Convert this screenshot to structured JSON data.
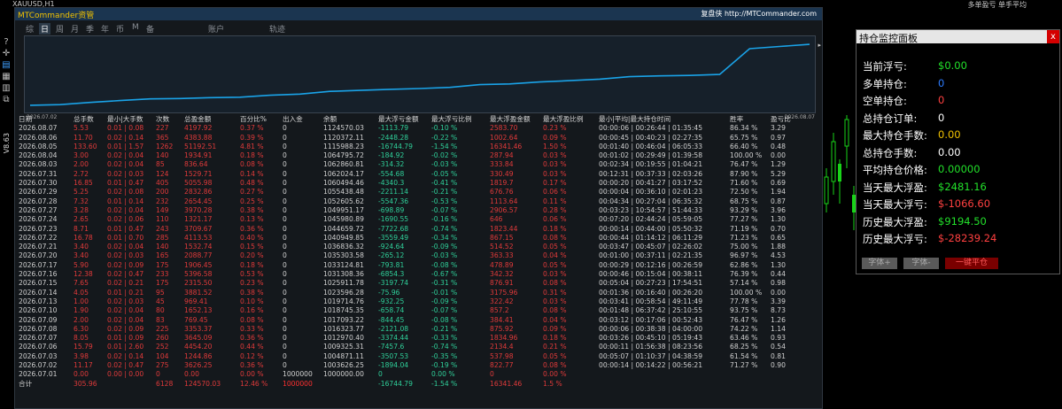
{
  "chart": {
    "symbol_title": "XAUUSD,H1",
    "top_right_text": "多单盈亏 单手平均",
    "version_label": "V8.63"
  },
  "toolbar": {
    "icons": [
      "question-icon",
      "crosshair-icon",
      "chart-icon",
      "grid-icon",
      "table-icon",
      "window-icon"
    ]
  },
  "panel": {
    "title": "MTCommander资管",
    "link": "复盘侠 http://MTCommander.com",
    "tabs": [
      "综",
      "日",
      "周",
      "月",
      "季",
      "年",
      "币",
      "M",
      "备",
      "账户",
      "轨迹"
    ],
    "active_tab": "日",
    "chart_start_date": "2026.07.02",
    "chart_end_date": "2026.08.07"
  },
  "chart_data": {
    "type": "line",
    "x": [
      "2026.07.02",
      "2026.07.03",
      "2026.07.06",
      "2026.07.07",
      "2026.07.08",
      "2026.07.09",
      "2026.07.10",
      "2026.07.13",
      "2026.07.14",
      "2026.07.15",
      "2026.07.16",
      "2026.07.17",
      "2026.07.20",
      "2026.07.21",
      "2026.07.22",
      "2026.07.23",
      "2026.07.24",
      "2026.07.27",
      "2026.07.28",
      "2026.07.29",
      "2026.07.30",
      "2026.07.31",
      "2026.08.03",
      "2026.08.04",
      "2026.08.05",
      "2026.08.06",
      "2026.08.07"
    ],
    "y": [
      1003626.25,
      1004871.11,
      1009325.31,
      1012970.4,
      1016323.77,
      1017093.22,
      1018745.35,
      1019714.76,
      1023596.28,
      1025911.78,
      1031308.36,
      1033124.81,
      1035303.58,
      1036836.32,
      1039187.64,
      1044659.72,
      1045980.89,
      1049951.17,
      1052605.62,
      1055438.48,
      1060494.46,
      1062024.17,
      1062860.81,
      1064795.72,
      1115988.23,
      1120372.11,
      1124570.03
    ],
    "ylim": [
      1000000,
      1130000
    ]
  },
  "table": {
    "headers": [
      "日期",
      "总手数",
      "最小|大手数",
      "次数",
      "总盈金额",
      "百分比%",
      "出入金",
      "余额",
      "最大浮亏金额",
      "最大浮亏比例",
      "最大浮盈金额",
      "最大浮盈比例",
      "最小|平均|最大持仓时间",
      "胜率",
      "盈亏比"
    ],
    "rows": [
      [
        "2026.08.07",
        "5.53",
        "0.01 | 0.08",
        "227",
        "4197.92",
        "0.37 %",
        "0",
        "1124570.03",
        "-1113.79",
        "-0.10 %",
        "2583.70",
        "0.23 %",
        "00:00:06 | 00:26:44 | 01:35:45",
        "86.34 %",
        "3.29"
      ],
      [
        "2026.08.06",
        "11.70",
        "0.02 | 0.14",
        "365",
        "4383.88",
        "0.39 %",
        "0",
        "1120372.11",
        "-2448.28",
        "-0.22 %",
        "1002.64",
        "0.09 %",
        "00:00:45 | 00:40:23 | 02:27:35",
        "65.75 %",
        "0.97"
      ],
      [
        "2026.08.05",
        "133.60",
        "0.01 | 1.57",
        "1262",
        "51192.51",
        "4.81 %",
        "0",
        "1115988.23",
        "-16744.79",
        "-1.54 %",
        "16341.46",
        "1.50 %",
        "00:01:40 | 00:46:04 | 06:05:33",
        "66.40 %",
        "0.48"
      ],
      [
        "2026.08.04",
        "3.00",
        "0.02 | 0.04",
        "140",
        "1934.91",
        "0.18 %",
        "0",
        "1064795.72",
        "-184.92",
        "-0.02 %",
        "287.94",
        "0.03 %",
        "00:01:02 | 00:29:49 | 01:39:58",
        "100.00 %",
        "0.00"
      ],
      [
        "2026.08.03",
        "2.00",
        "0.02 | 0.04",
        "85",
        "836.64",
        "0.08 %",
        "0",
        "1062860.81",
        "-314.32",
        "-0.03 %",
        "333.84",
        "0.03 %",
        "00:02:34 | 00:19:55 | 01:04:21",
        "76.47 %",
        "1.29"
      ],
      [
        "2026.07.31",
        "2.72",
        "0.02 | 0.03",
        "124",
        "1529.71",
        "0.14 %",
        "0",
        "1062024.17",
        "-554.68",
        "-0.05 %",
        "330.49",
        "0.03 %",
        "00:12:31 | 00:37:33 | 02:03:26",
        "87.90 %",
        "5.29"
      ],
      [
        "2026.07.30",
        "16.85",
        "0.01 | 0.47",
        "405",
        "5055.98",
        "0.48 %",
        "0",
        "1060494.46",
        "-4340.3",
        "-0.41 %",
        "1819.7",
        "0.17 %",
        "00:00:20 | 00:41:27 | 03:17:52",
        "71.60 %",
        "0.69"
      ],
      [
        "2026.07.29",
        "5.25",
        "0.02 | 0.08",
        "200",
        "2832.86",
        "0.27 %",
        "0",
        "1055438.48",
        "-2211.14",
        "-0.21 %",
        "676.76",
        "0.06 %",
        "00:00:04 | 00:36:10 | 02:01:23",
        "72.50 %",
        "1.94"
      ],
      [
        "2026.07.28",
        "7.32",
        "0.01 | 0.14",
        "232",
        "2654.45",
        "0.25 %",
        "0",
        "1052605.62",
        "-5547.36",
        "-0.53 %",
        "1113.64",
        "0.11 %",
        "00:04:34 | 00:27:04 | 06:35:32",
        "68.75 %",
        "0.87"
      ],
      [
        "2026.07.27",
        "3.28",
        "0.02 | 0.04",
        "149",
        "3970.28",
        "0.38 %",
        "0",
        "1049951.17",
        "-698.89",
        "-0.07 %",
        "2906.57",
        "0.28 %",
        "00:03:23 | 10:54:57 | 51:44:33",
        "93.29 %",
        "3.96"
      ],
      [
        "2026.07.24",
        "2.65",
        "0.02 | 0.06",
        "110",
        "1321.17",
        "0.13 %",
        "0",
        "1045980.89",
        "-1690.55",
        "-0.16 %",
        "646",
        "0.06 %",
        "00:07:20 | 02:44:24 | 05:59:05",
        "77.27 %",
        "1.30"
      ],
      [
        "2026.07.23",
        "8.71",
        "0.01 | 0.47",
        "243",
        "3709.67",
        "0.36 %",
        "0",
        "1044659.72",
        "-7722.68",
        "-0.74 %",
        "1823.44",
        "0.18 %",
        "00:00:14 | 00:44:00 | 05:50:32",
        "71.19 %",
        "0.70"
      ],
      [
        "2026.07.22",
        "16.78",
        "0.01 | 0.70",
        "285",
        "4113.53",
        "0.40 %",
        "0",
        "1040949.85",
        "-3559.49",
        "-0.34 %",
        "867.15",
        "0.08 %",
        "00:00:44 | 01:14:12 | 06:11:29",
        "71.23 %",
        "0.65"
      ],
      [
        "2026.07.21",
        "3.40",
        "0.02 | 0.04",
        "140",
        "1532.74",
        "0.15 %",
        "0",
        "1036836.32",
        "-924.64",
        "-0.09 %",
        "514.52",
        "0.05 %",
        "00:03:47 | 00:45:07 | 02:26:02",
        "75.00 %",
        "1.88"
      ],
      [
        "2026.07.20",
        "3.40",
        "0.02 | 0.03",
        "165",
        "2088.77",
        "0.20 %",
        "0",
        "1035303.58",
        "-265.12",
        "-0.03 %",
        "363.33",
        "0.04 %",
        "00:01:00 | 00:37:11 | 02:21:35",
        "96.97 %",
        "4.53"
      ],
      [
        "2026.07.17",
        "5.90",
        "0.02 | 0.09",
        "175",
        "1906.45",
        "0.18 %",
        "0",
        "1033124.81",
        "-793.81",
        "-0.08 %",
        "478.89",
        "0.05 %",
        "00:00:29 | 00:12:16 | 00:26:59",
        "62.86 %",
        "1.30"
      ],
      [
        "2026.07.16",
        "12.38",
        "0.02 | 0.47",
        "233",
        "5396.58",
        "0.53 %",
        "0",
        "1031308.36",
        "-6854.3",
        "-0.67 %",
        "342.32",
        "0.03 %",
        "00:00:46 | 00:15:04 | 00:38:11",
        "76.39 %",
        "0.44"
      ],
      [
        "2026.07.15",
        "7.65",
        "0.02 | 0.21",
        "175",
        "2315.50",
        "0.23 %",
        "0",
        "1025911.78",
        "-3197.74",
        "-0.31 %",
        "876.91",
        "0.08 %",
        "00:05:04 | 00:27:23 | 17:54:51",
        "57.14 %",
        "0.98"
      ],
      [
        "2026.07.14",
        "4.05",
        "0.01 | 0.21",
        "95",
        "3881.52",
        "0.38 %",
        "0",
        "1023596.28",
        "-75.96",
        "-0.01 %",
        "3175.96",
        "0.31 %",
        "00:01:36 | 00:16:40 | 00:26:20",
        "100.00 %",
        "0.00"
      ],
      [
        "2026.07.13",
        "1.00",
        "0.02 | 0.03",
        "45",
        "969.41",
        "0.10 %",
        "0",
        "1019714.76",
        "-932.25",
        "-0.09 %",
        "322.42",
        "0.03 %",
        "00:03:41 | 00:58:54 | 49:11:49",
        "77.78 %",
        "3.39"
      ],
      [
        "2026.07.10",
        "1.90",
        "0.02 | 0.04",
        "80",
        "1652.13",
        "0.16 %",
        "0",
        "1018745.35",
        "-658.74",
        "-0.07 %",
        "857.2",
        "0.08 %",
        "00:01:48 | 06:37:42 | 25:10:55",
        "93.75 %",
        "8.73"
      ],
      [
        "2026.07.09",
        "2.00",
        "0.02 | 0.04",
        "83",
        "769.45",
        "0.08 %",
        "0",
        "1017093.22",
        "-844.45",
        "-0.08 %",
        "384.41",
        "0.04 %",
        "00:03:12 | 00:17:06 | 00:52:43",
        "76.47 %",
        "1.26"
      ],
      [
        "2026.07.08",
        "6.30",
        "0.02 | 0.09",
        "225",
        "3353.37",
        "0.33 %",
        "0",
        "1016323.77",
        "-2121.08",
        "-0.21 %",
        "875.92",
        "0.09 %",
        "00:00:06 | 00:38:38 | 04:00:00",
        "74.22 %",
        "1.14"
      ],
      [
        "2026.07.07",
        "8.05",
        "0.01 | 0.09",
        "260",
        "3645.09",
        "0.36 %",
        "0",
        "1012970.40",
        "-3374.44",
        "-0.33 %",
        "1834.96",
        "0.18 %",
        "00:03:26 | 00:45:10 | 05:19:43",
        "63.46 %",
        "0.93"
      ],
      [
        "2026.07.06",
        "15.79",
        "0.01 | 2.60",
        "252",
        "4454.20",
        "0.44 %",
        "0",
        "1009325.31",
        "-7457.6",
        "-0.74 %",
        "2134.4",
        "0.21 %",
        "00:00:11 | 01:56:38 | 08:23:56",
        "68.25 %",
        "0.54"
      ],
      [
        "2026.07.03",
        "3.98",
        "0.02 | 0.14",
        "104",
        "1244.86",
        "0.12 %",
        "0",
        "1004871.11",
        "-3507.53",
        "-0.35 %",
        "537.98",
        "0.05 %",
        "00:05:07 | 01:10:37 | 04:38:59",
        "61.54 %",
        "0.81"
      ],
      [
        "2026.07.02",
        "11.17",
        "0.02 | 0.47",
        "275",
        "3626.25",
        "0.36 %",
        "0",
        "1003626.25",
        "-1894.04",
        "-0.19 %",
        "822.77",
        "0.08 %",
        "00:00:14 | 00:14:22 | 00:56:21",
        "71.27 %",
        "0.90"
      ],
      [
        "2026.07.01",
        "0.00",
        "0.00 | 0.00",
        "0",
        "0.00",
        "0.00 %",
        "1000000",
        "1000000.00",
        "0",
        "0.00 %",
        "0",
        "0.00 %",
        "",
        "",
        ""
      ]
    ],
    "total": [
      "合计",
      "305.96",
      "",
      "6128",
      "124570.03",
      "12.46 %",
      "1000000",
      "",
      "-16744.79",
      "-1.54 %",
      "16341.46",
      "1.5 %",
      "",
      "",
      ""
    ]
  },
  "side_panel": {
    "title": "持仓监控面板",
    "close": "x",
    "rows": [
      {
        "label": "当前浮亏:",
        "value": "$0.00",
        "color": "#22e02a"
      },
      {
        "label": "多单持仓:",
        "value": "0",
        "color": "#2d7cff"
      },
      {
        "label": "空单持仓:",
        "value": "0",
        "color": "#ff4040"
      },
      {
        "label": "总持仓订单:",
        "value": "0",
        "color": "#ffffff"
      },
      {
        "label": "最大持仓手数:",
        "value": "0.00",
        "color": "#f2c200"
      },
      {
        "label": "总持仓手数:",
        "value": "0.00",
        "color": "#ffffff"
      },
      {
        "label": "平均持仓价格:",
        "value": "0.00000",
        "color": "#22e02a"
      },
      {
        "label": "当天最大浮盈:",
        "value": "$2481.16",
        "color": "#22e02a"
      },
      {
        "label": "当天最大浮亏:",
        "value": "$-1066.60",
        "color": "#ff4040"
      },
      {
        "label": "历史最大浮盈:",
        "value": "$9194.50",
        "color": "#22e02a"
      },
      {
        "label": "历史最大浮亏:",
        "value": "$-28239.24",
        "color": "#ff4040"
      }
    ],
    "buttons": [
      "字体+",
      "字体-",
      "一键平仓"
    ]
  }
}
